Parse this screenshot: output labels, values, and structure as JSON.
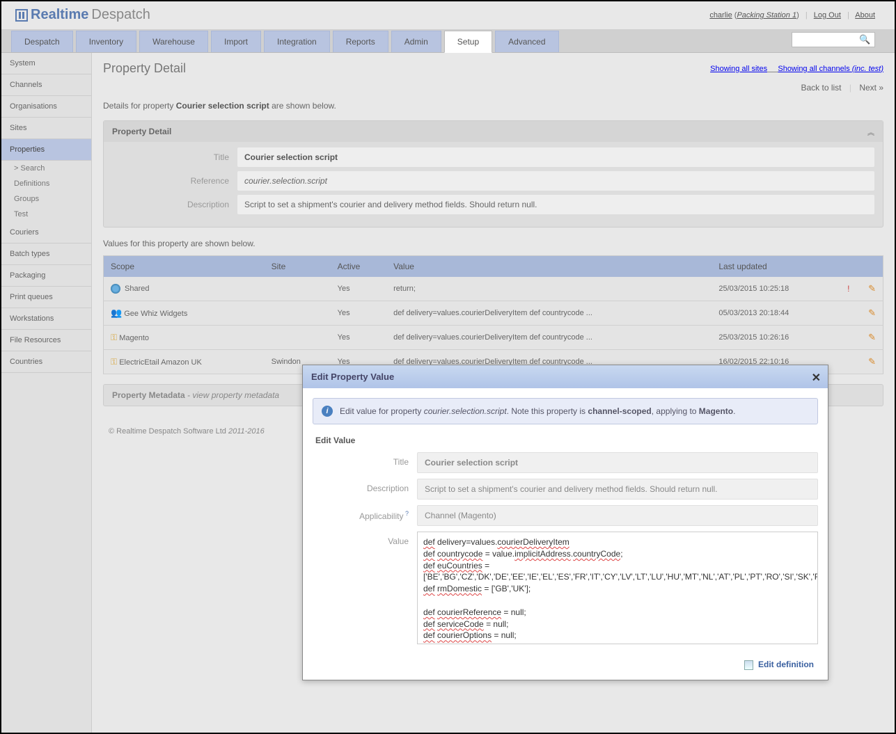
{
  "header": {
    "logo1": "Realtime",
    "logo2": "Despatch",
    "user": "charlie",
    "station": "Packing Station 1",
    "logout": "Log Out",
    "about": "About"
  },
  "tabs": [
    "Despatch",
    "Inventory",
    "Warehouse",
    "Import",
    "Integration",
    "Reports",
    "Admin",
    "Setup",
    "Advanced"
  ],
  "activeTab": "Setup",
  "sidebar": {
    "items": [
      "System",
      "Channels",
      "Organisations",
      "Sites",
      "Properties",
      "Couriers",
      "Batch types",
      "Packaging",
      "Print queues",
      "Workstations",
      "File Resources",
      "Countries"
    ],
    "active": "Properties",
    "subs": [
      "Search",
      "Definitions",
      "Groups",
      "Test"
    ]
  },
  "page": {
    "title": "Property Detail",
    "link1": "Showing all sites",
    "link2a": "Showing all channels ",
    "link2b": "(inc. test)",
    "nav_back": "Back to list",
    "nav_next": "Next  »",
    "details_prefix": "Details for property ",
    "details_name": "Courier selection script",
    "details_suffix": " are shown below."
  },
  "detailPanel": {
    "head": "Property Detail",
    "rows": {
      "title_label": "Title",
      "title_value": "Courier selection script",
      "reference_label": "Reference",
      "reference_value": "courier.selection.script",
      "description_label": "Description",
      "description_value": "Script to set a shipment's courier and delivery method fields. Should return null."
    }
  },
  "valuesHead": "Values for this property are shown below.",
  "table": {
    "cols": [
      "Scope",
      "Site",
      "Active",
      "Value",
      "Last updated"
    ],
    "rows": [
      {
        "icon": "globe",
        "scope": "Shared",
        "site": "",
        "active": "Yes",
        "value": "return;",
        "updated": "25/03/2015 10:25:18",
        "warn": true
      },
      {
        "icon": "people",
        "scope": "Gee Whiz Widgets",
        "site": "",
        "active": "Yes",
        "value": "def delivery=values.courierDeliveryItem def countrycode ...",
        "updated": "05/03/2013 20:18:44",
        "warn": false
      },
      {
        "icon": "key",
        "scope": "Magento",
        "site": "",
        "active": "Yes",
        "value": "def delivery=values.courierDeliveryItem def countrycode ...",
        "updated": "25/03/2015 10:26:16",
        "warn": false
      },
      {
        "icon": "key",
        "scope": "ElectricEtail Amazon UK",
        "site": "Swindon",
        "active": "Yes",
        "value": "def delivery=values.courierDeliveryItem def countrycode ...",
        "updated": "16/02/2015 22:10:16",
        "warn": false
      }
    ]
  },
  "metaPanel": {
    "head": "Property Metadata",
    "hint": "- view property metadata"
  },
  "footer": {
    "text": "© Realtime Despatch Software Ltd ",
    "years": "2011-2016"
  },
  "dialog": {
    "title": "Edit Property Value",
    "info_prefix": "Edit value for property ",
    "info_ref": "courier.selection.script",
    "info_mid": ". Note this property is ",
    "info_scope": "channel-scoped",
    "info_mid2": ", applying to ",
    "info_target": "Magento",
    "info_end": ".",
    "section": "Edit Value",
    "rows": {
      "title_label": "Title",
      "title_value": "Courier selection script",
      "desc_label": "Description",
      "desc_value": "Script to set a shipment's courier and delivery method fields. Should return null.",
      "app_label": "Applicability",
      "app_value": "Channel (Magento)",
      "value_label": "Value"
    },
    "script_text": "def delivery=values.courierDeliveryItem\ndef countrycode = value.implicitAddress.countryCode;\ndef euCountries = \n['BE','BG','CZ','DK','DE','EE','IE','EL','ES','FR','IT','CY','LV','LT','LU','HU','MT','NL','AT','PL','PT','RO','SI','SK','FI','SE']\ndef rmDomestic  = ['GB','UK'];\n\ndef courierReference = null;\ndef serviceCode = null;\ndef courierOptions = null;",
    "action": "Edit definition"
  }
}
